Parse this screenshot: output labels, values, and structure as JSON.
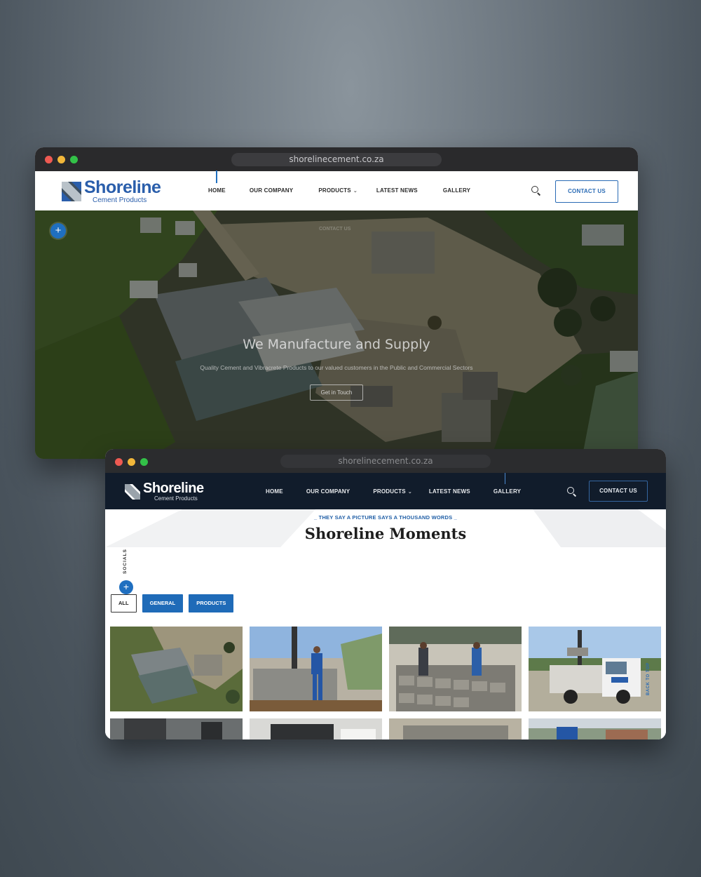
{
  "window1": {
    "url": "shorelinecement.co.za",
    "logo": {
      "name": "Shoreline",
      "tagline": "Cement Products"
    },
    "nav": [
      {
        "label": "HOME"
      },
      {
        "label": "OUR COMPANY"
      },
      {
        "label": "PRODUCTS",
        "has_dropdown": true
      },
      {
        "label": "LATEST NEWS"
      },
      {
        "label": "GALLERY"
      }
    ],
    "contact_label": "CONTACT US",
    "hero": {
      "ghost_label": "CONTACT US",
      "title": "We Manufacture and Supply",
      "subtitle": "Quality Cement and Vibracrete Products to our valued customers in the Public and Commercial Sectors",
      "button_label": "Get in Touch"
    },
    "plus_label": "+"
  },
  "window2": {
    "url": "shorelinecement.co.za",
    "logo": {
      "name": "Shoreline",
      "tagline": "Cement Products"
    },
    "nav": [
      {
        "label": "HOME"
      },
      {
        "label": "OUR COMPANY"
      },
      {
        "label": "PRODUCTS",
        "has_dropdown": true
      },
      {
        "label": "LATEST NEWS"
      },
      {
        "label": "GALLERY"
      }
    ],
    "contact_label": "CONTACT US",
    "eyebrow": "THEY SAY A PICTURE SAYS A THOUSAND WORDS",
    "title": "Shoreline Moments",
    "socials_label": "SOCIALS",
    "plus_label": "+",
    "back_to_top_label": "BACK TO TOP",
    "filters": [
      {
        "label": "ALL",
        "active": true
      },
      {
        "label": "GENERAL",
        "active": false
      },
      {
        "label": "PRODUCTS",
        "active": false
      }
    ],
    "gallery_count_visible": 8
  },
  "colors": {
    "brand_blue": "#2a5eab",
    "accent_blue": "#1f6fc0",
    "dark_nav": "#111c2b"
  }
}
